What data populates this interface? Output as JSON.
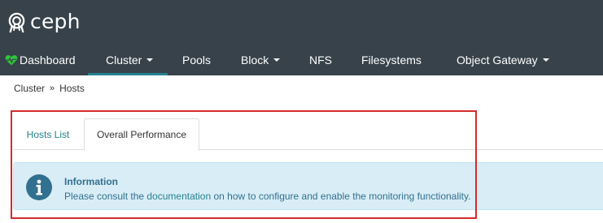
{
  "brand": {
    "logo_icon": "ceph-logo-icon",
    "name": "ceph"
  },
  "nav": {
    "items": [
      {
        "label": "Dashboard",
        "icon": "heart-pulse-icon",
        "has_dropdown": false
      },
      {
        "label": "Cluster",
        "has_dropdown": true,
        "active": true
      },
      {
        "label": "Pools",
        "has_dropdown": false
      },
      {
        "label": "Block",
        "has_dropdown": true
      },
      {
        "label": "NFS",
        "has_dropdown": false
      },
      {
        "label": "Filesystems",
        "has_dropdown": false
      },
      {
        "label": "Object Gateway",
        "has_dropdown": true
      }
    ]
  },
  "breadcrumb": {
    "items": [
      "Cluster",
      "Hosts"
    ],
    "separator": "»"
  },
  "tabs": [
    {
      "label": "Hosts List",
      "active": false
    },
    {
      "label": "Overall Performance",
      "active": true
    }
  ],
  "alert": {
    "icon": "info-circle-icon",
    "title": "Information",
    "text_before": "Please consult the ",
    "link_text": "documentation",
    "text_after": " on how to configure and enable the monitoring functionality."
  },
  "colors": {
    "topbar": "#37424a",
    "accent": "#25828e",
    "heart": "#2fc53a",
    "alert_bg": "#d9edf7",
    "alert_text": "#31708f",
    "highlight_box": "#d42a2a"
  }
}
